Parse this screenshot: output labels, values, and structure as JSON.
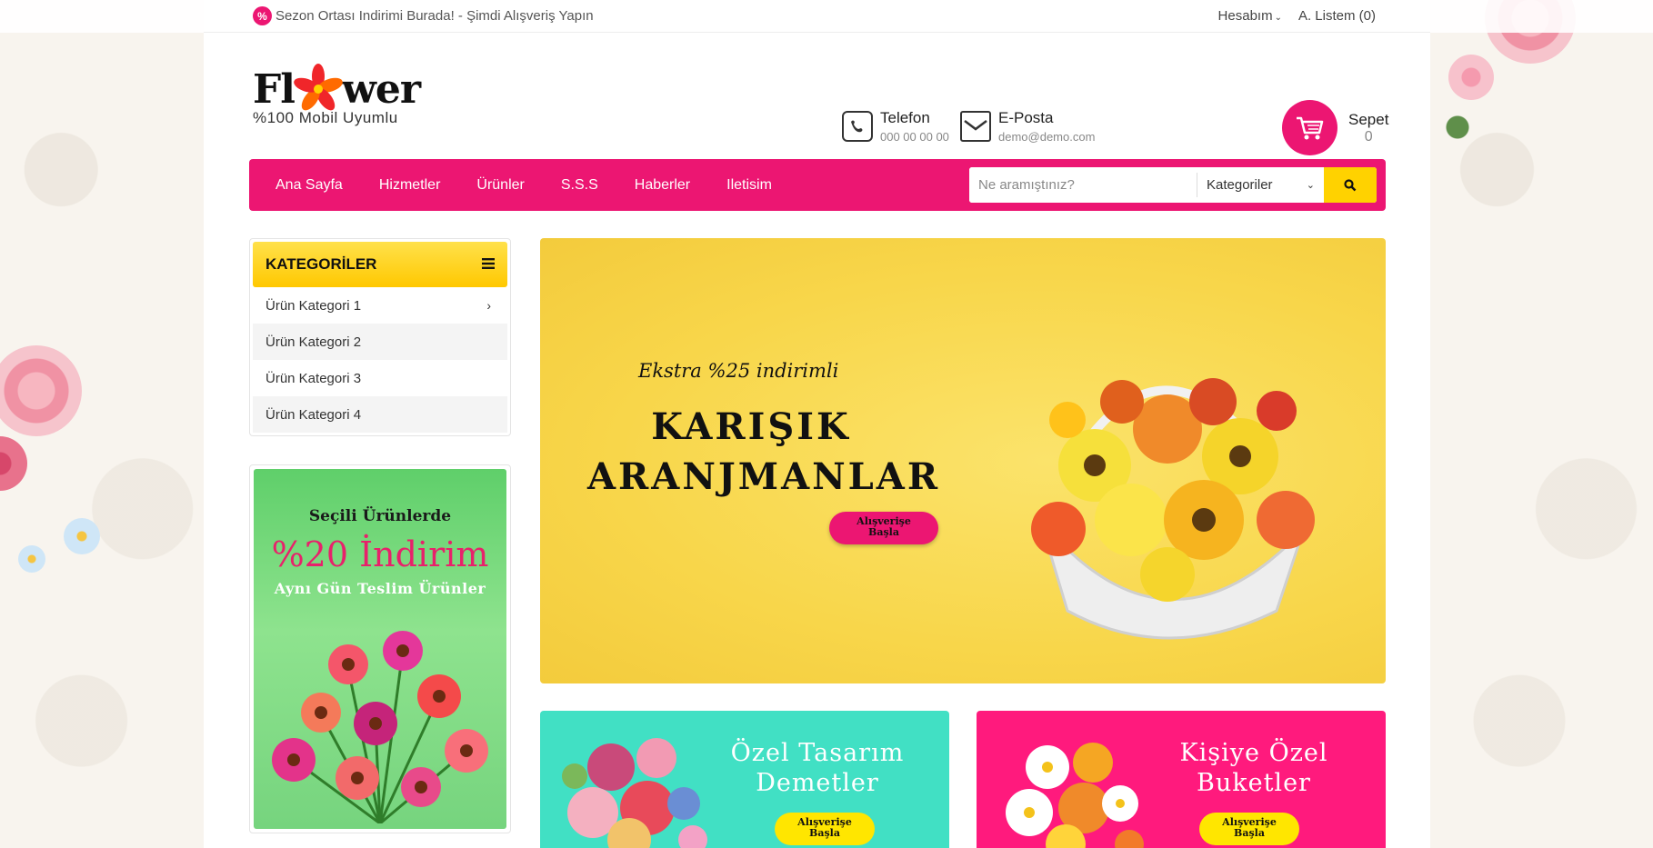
{
  "topbar": {
    "promo_icon": "percent-badge-icon",
    "promo_text": "Sezon Ortası Indirimi Burada! - Şimdi Alışveriş Yapın",
    "account_label": "Hesabım",
    "wishlist_label": "A. Listem (0)"
  },
  "header": {
    "logo_pre": "Fl",
    "logo_post": "wer",
    "logo_sub": "%100 Mobil Uyumlu",
    "phone_title": "Telefon",
    "phone_value": "000 00 00 00",
    "email_title": "E-Posta",
    "email_value": "demo@demo.com",
    "cart_title": "Sepet",
    "cart_count": "0"
  },
  "nav": {
    "items": [
      "Ana Sayfa",
      "Hizmetler",
      "Ürünler",
      "S.S.S",
      "Haberler",
      "Iletisim"
    ]
  },
  "search": {
    "placeholder": "Ne aramıştınız?",
    "category_select": "Kategoriler"
  },
  "sidebar": {
    "categories_title": "KATEGORİLER",
    "categories": [
      "Ürün Kategori 1",
      "Ürün Kategori 2",
      "Ürün Kategori 3",
      "Ürün Kategori 4"
    ],
    "promo_line1": "Seçili Ürünlerde",
    "promo_line2": "%20 İndirim",
    "promo_line3": "Aynı Gün Teslim Ürünler"
  },
  "hero": {
    "subtitle": "Ekstra %25 indirimli",
    "title_line1": "KARIŞIK",
    "title_line2": "ARANJMANLAR",
    "button_line1": "Alışverişe",
    "button_line2": "Başla"
  },
  "tiles": [
    {
      "title_line1": "Özel Tasarım",
      "title_line2": "Demetler",
      "button_line1": "Alışverişe",
      "button_line2": "Başla"
    },
    {
      "title_line1": "Kişiye Özel",
      "title_line2": "Buketler",
      "button_line1": "Alışverişe",
      "button_line2": "Başla"
    }
  ],
  "colors": {
    "brand_pink": "#ec1672",
    "accent_yellow": "#ffd200",
    "tile_teal": "#41e0c4"
  }
}
